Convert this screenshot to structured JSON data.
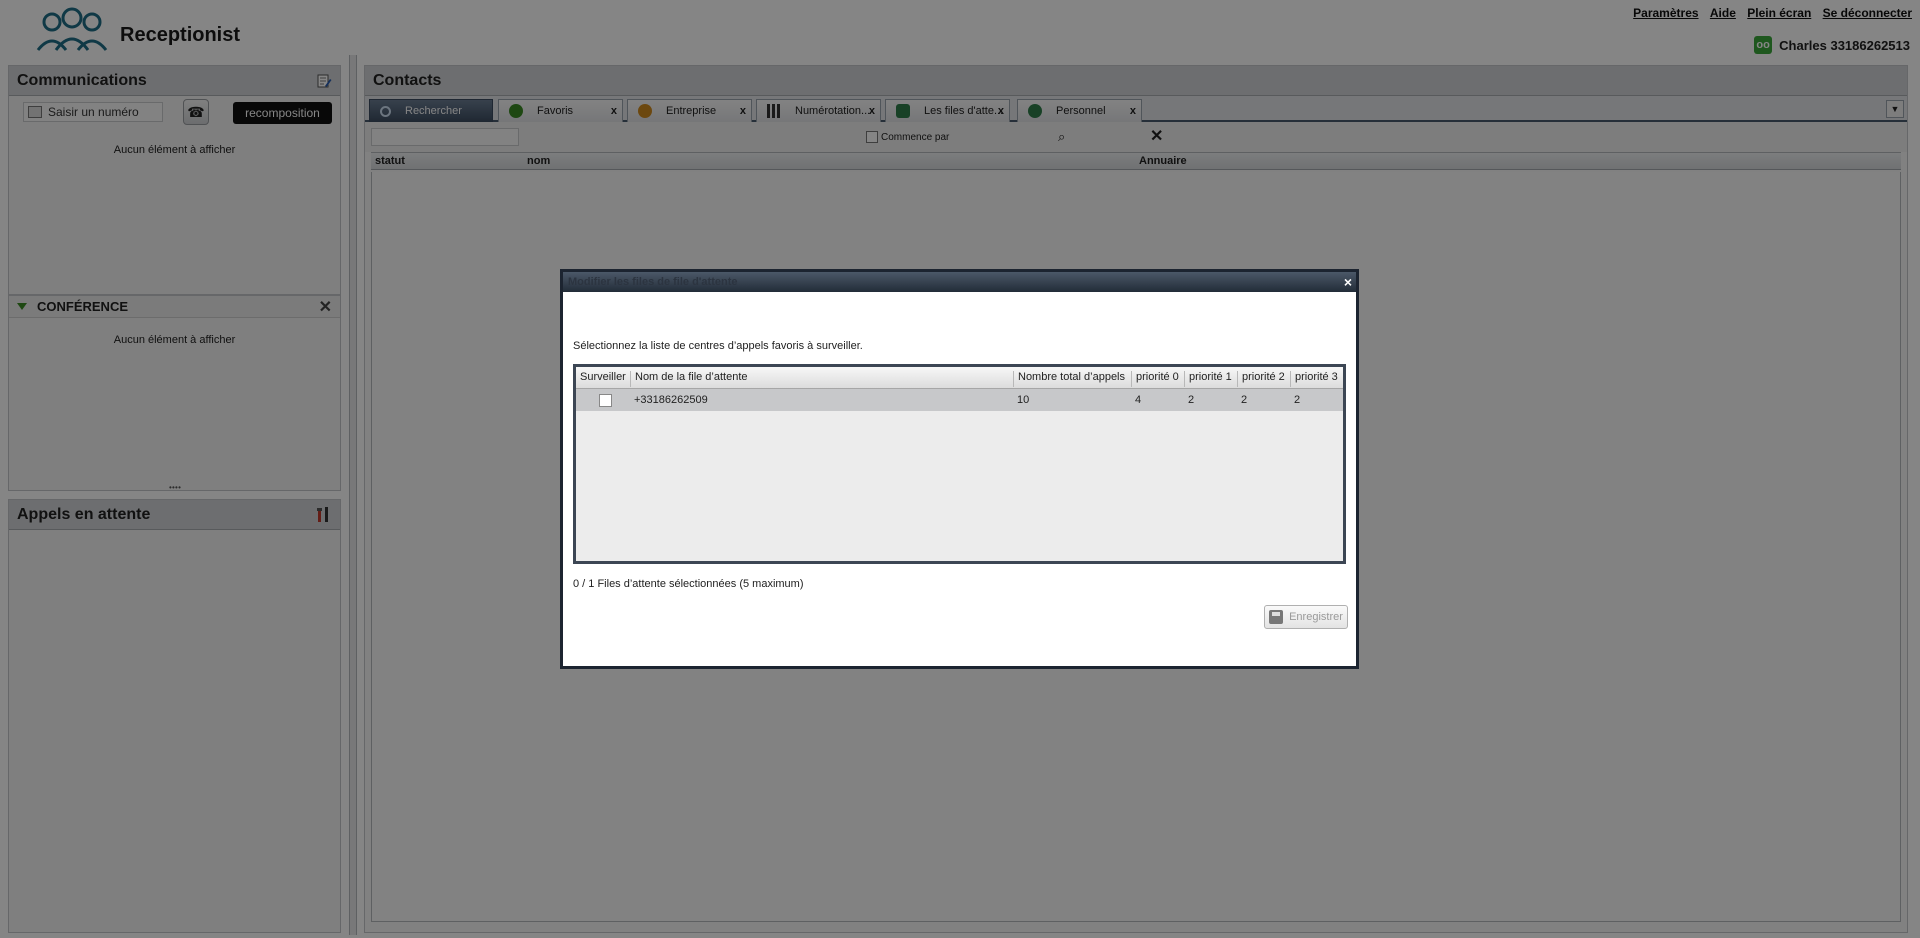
{
  "app": {
    "title": "Receptionist"
  },
  "top_links": [
    "Paramètres",
    "Aide",
    "Plein écran",
    "Se déconnecter"
  ],
  "user": {
    "label": "Charles 33186262513",
    "status_color": "#3aa83a"
  },
  "communications": {
    "title": "Communications",
    "dial_placeholder": "Saisir un numéro",
    "redial_label": "recomposition",
    "empty": "Aucun élément à afficher"
  },
  "conference": {
    "title": "CONFÉRENCE",
    "empty": "Aucun élément à afficher"
  },
  "waiting_calls": {
    "title": "Appels en attente"
  },
  "contacts": {
    "title": "Contacts",
    "tabs": [
      {
        "label": "Rechercher",
        "icon": "search-icon",
        "closable": false
      },
      {
        "label": "Favoris",
        "icon": "favorites-icon",
        "closable": true
      },
      {
        "label": "Entreprise",
        "icon": "company-icon",
        "closable": true
      },
      {
        "label": "Numérotation...",
        "icon": "dialpad-icon",
        "closable": true
      },
      {
        "label": "Les files d'atte...",
        "icon": "queue-icon",
        "closable": true
      },
      {
        "label": "Personnel",
        "icon": "personal-icon",
        "closable": true
      }
    ],
    "tab_close": "x",
    "starts_with": "Commence par",
    "columns": [
      "statut",
      "nom",
      "Annuaire"
    ]
  },
  "modal": {
    "title": "Modifier les files de file d'attente",
    "close": "×",
    "intro": "Sélectionnez la liste de centres d’appels favoris à surveiller.",
    "columns": [
      "Surveiller",
      "Nom de la file d’attente",
      "Nombre total d’appels",
      "priorité 0",
      "priorité 1",
      "priorité 2",
      "priorité 3"
    ],
    "rows": [
      {
        "checked": false,
        "name": "+33186262509",
        "total": "10",
        "p0": "4",
        "p1": "2",
        "p2": "2",
        "p3": "2"
      }
    ],
    "count": "0 / 1 Files d’attente sélectionnées (5 maximum)",
    "save_label": "Enregistrer"
  }
}
